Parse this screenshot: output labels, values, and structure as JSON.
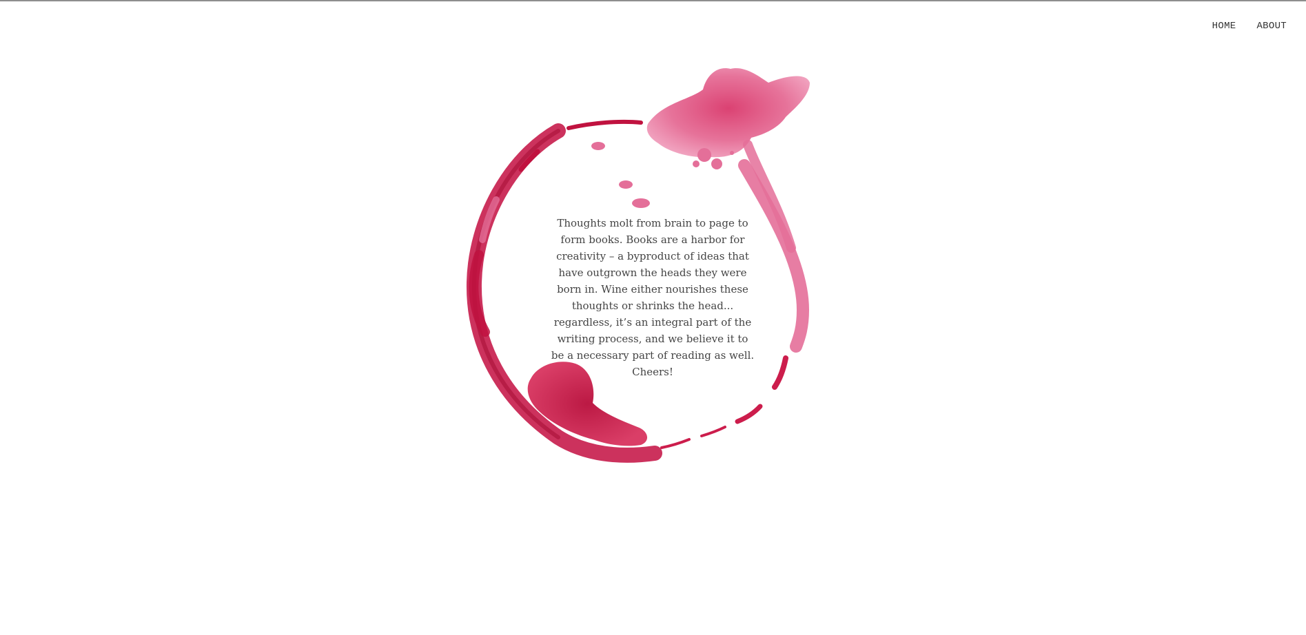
{
  "nav": {
    "items": [
      {
        "label": "HOME"
      },
      {
        "label": "ABOUT"
      }
    ]
  },
  "hero": {
    "blurb": "Thoughts molt from brain to page to form books. Books are a harbor for creativity – a byproduct of ideas that have outgrown the heads they were born in. Wine either nourishes these thoughts or shrinks the head... regardless, it’s an integral part of the writing process, and we believe it to be a necessary part of reading as well. Cheers!"
  },
  "colors": {
    "stain_dark": "#c0123f",
    "stain_mid": "#d9386b",
    "stain_light": "#e87aa3",
    "text": "#444444",
    "nav_text": "#333333"
  },
  "icons": {
    "stain": "wine-stain-ring-image"
  }
}
